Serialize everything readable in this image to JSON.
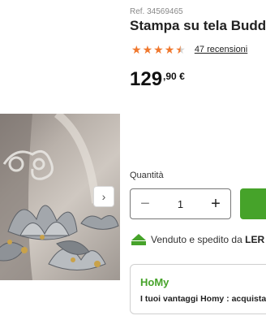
{
  "product": {
    "ref": "Ref. 34569465",
    "title": "Stampa su tela Budd",
    "rating": 4.5,
    "reviews_label": "47 recensioni",
    "price_integer": "129",
    "price_decimal": ",90 €"
  },
  "carousel": {
    "next_icon": "chevron-right-icon"
  },
  "purchase": {
    "quantity_label": "Quantità",
    "quantity_value": "1"
  },
  "shipping": {
    "prefix": "Venduto e spedito da ",
    "seller": "LER"
  },
  "homy": {
    "logo": "HoMy",
    "text": "I tuoi vantaggi Homy : acquistan"
  },
  "colors": {
    "accent_green": "#46a32a",
    "star_orange": "#f0782e"
  }
}
